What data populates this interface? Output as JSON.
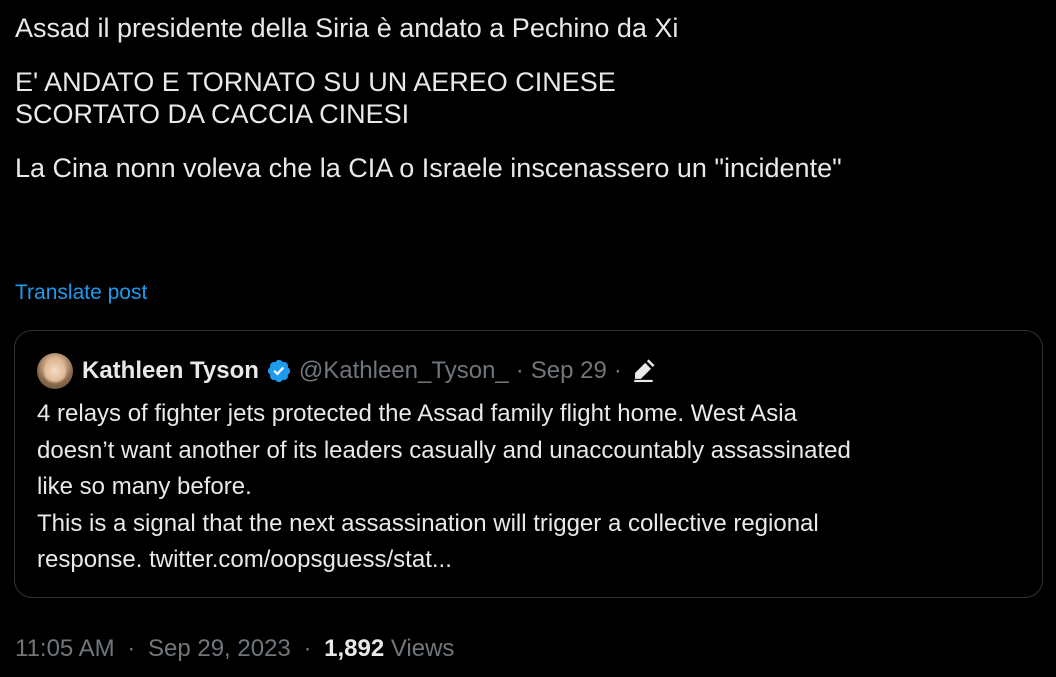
{
  "tweet": {
    "lines": [
      "Assad il presidente della Siria è andato a Pechino da Xi",
      "E' ANDATO E TORNATO SU UN AEREO CINESE",
      "SCORTATO DA CACCIA CINESI",
      "La Cina nonn voleva che la CIA o Israele inscenassero un \"incidente\""
    ],
    "translate_label": "Translate post"
  },
  "quote": {
    "author_name": "Kathleen Tyson",
    "handle": "@Kathleen_Tyson_",
    "separator": "·",
    "date": "Sep 29",
    "icons": {
      "verified": "verified-badge-icon",
      "edit": "edited-pencil-icon"
    },
    "body_lines": [
      "4 relays of fighter jets protected the Assad family flight home. West Asia",
      "doesn’t want another of its leaders casually and unaccountably assassinated",
      "like so many before.",
      "This is a signal that the next assassination will trigger a collective regional",
      "response. twitter.com/oopsguess/stat..."
    ]
  },
  "footer": {
    "time": "11:05 AM",
    "date": "Sep 29, 2023",
    "separator": "·",
    "views_count": "1,892",
    "views_label": "Views"
  },
  "colors": {
    "background": "#000000",
    "text": "#e7e9ea",
    "muted": "#71767b",
    "accent": "#1d9bf0",
    "border": "#2f3336"
  }
}
